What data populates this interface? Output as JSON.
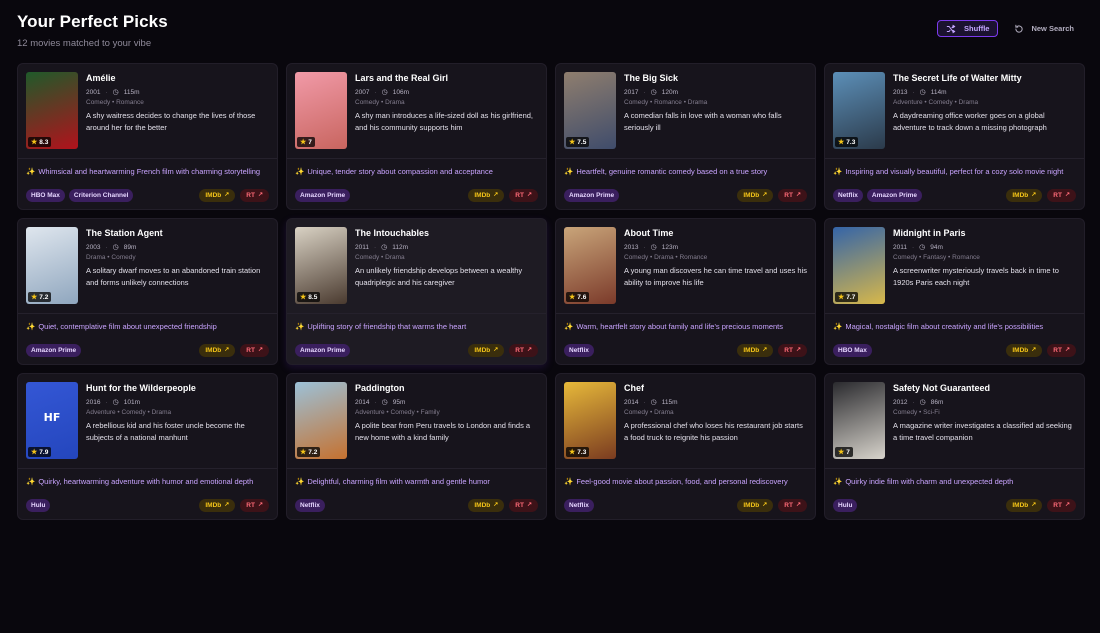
{
  "header": {
    "title": "Your Perfect Picks",
    "subtitle": "12 movies matched to your vibe",
    "shuffle_label": "Shuffle",
    "new_search_label": "New Search"
  },
  "labels": {
    "imdb": "IMDb",
    "rt": "RT"
  },
  "icons": {
    "shuffle": "shuffle-icon",
    "new_search": "refresh-icon",
    "clock": "clock-icon",
    "star": "star-icon",
    "sparkle": "sparkle-icon",
    "external": "external-link-icon"
  },
  "colors": {
    "accent": "#7c3aed",
    "vibe_text": "#c9a4ff",
    "imdb": "#f5c518",
    "rt": "#ff6b78",
    "card_bg": "#17141c",
    "page_bg": "#09070d"
  },
  "movies": [
    {
      "title": "Amélie",
      "year": "2001",
      "runtime": "115m",
      "genres": "Comedy • Romance",
      "rating": "8.3",
      "description": "A shy waitress decides to change the lives of those around her for the better",
      "vibe": "Whimsical and heartwarming French film with charming storytelling",
      "platforms": [
        "HBO Max",
        "Criterion Channel"
      ],
      "poster_colors": [
        "#1f5a2a",
        "#b2121c"
      ],
      "poster_text": ""
    },
    {
      "title": "Lars and the Real Girl",
      "year": "2007",
      "runtime": "106m",
      "genres": "Comedy • Drama",
      "rating": "7",
      "description": "A shy man introduces a life-sized doll as his girlfriend, and his community supports him",
      "vibe": "Unique, tender story about compassion and acceptance",
      "platforms": [
        "Amazon Prime"
      ],
      "poster_colors": [
        "#f19aa8",
        "#c8655f"
      ],
      "poster_text": ""
    },
    {
      "title": "The Big Sick",
      "year": "2017",
      "runtime": "120m",
      "genres": "Comedy • Romance • Drama",
      "rating": "7.5",
      "description": "A comedian falls in love with a woman who falls seriously ill",
      "vibe": "Heartfelt, genuine romantic comedy based on a true story",
      "platforms": [
        "Amazon Prime"
      ],
      "poster_colors": [
        "#8f7e6e",
        "#3f4c6b"
      ],
      "poster_text": ""
    },
    {
      "title": "The Secret Life of Walter Mitty",
      "year": "2013",
      "runtime": "114m",
      "genres": "Adventure • Comedy • Drama",
      "rating": "7.3",
      "description": "A daydreaming office worker goes on a global adventure to track down a missing photograph",
      "vibe": "Inspiring and visually beautiful, perfect for a cozy solo movie night",
      "platforms": [
        "Netflix",
        "Amazon Prime"
      ],
      "poster_colors": [
        "#5c8fb8",
        "#2b3a4a"
      ],
      "poster_text": ""
    },
    {
      "title": "The Station Agent",
      "year": "2003",
      "runtime": "89m",
      "genres": "Drama • Comedy",
      "rating": "7.2",
      "description": "A solitary dwarf moves to an abandoned train station and forms unlikely connections",
      "vibe": "Quiet, contemplative film about unexpected friendship",
      "platforms": [
        "Amazon Prime"
      ],
      "poster_colors": [
        "#dfe6ee",
        "#8fa6be"
      ],
      "poster_text": ""
    },
    {
      "title": "The Intouchables",
      "year": "2011",
      "runtime": "112m",
      "genres": "Comedy • Drama",
      "rating": "8.5",
      "description": "An unlikely friendship develops between a wealthy quadriplegic and his caregiver",
      "vibe": "Uplifting story of friendship that warms the heart",
      "platforms": [
        "Amazon Prime"
      ],
      "poster_colors": [
        "#d9d2c4",
        "#4a3a2f"
      ],
      "poster_text": ""
    },
    {
      "title": "About Time",
      "year": "2013",
      "runtime": "123m",
      "genres": "Comedy • Drama • Romance",
      "rating": "7.6",
      "description": "A young man discovers he can time travel and uses his ability to improve his life",
      "vibe": "Warm, heartfelt story about family and life's precious moments",
      "platforms": [
        "Netflix"
      ],
      "poster_colors": [
        "#c9a57a",
        "#7b3a2a"
      ],
      "poster_text": ""
    },
    {
      "title": "Midnight in Paris",
      "year": "2011",
      "runtime": "94m",
      "genres": "Comedy • Fantasy • Romance",
      "rating": "7.7",
      "description": "A screenwriter mysteriously travels back in time to 1920s Paris each night",
      "vibe": "Magical, nostalgic film about creativity and life's possibilities",
      "platforms": [
        "HBO Max"
      ],
      "poster_colors": [
        "#3464a8",
        "#d8b84a"
      ],
      "poster_text": ""
    },
    {
      "title": "Hunt for the Wilderpeople",
      "year": "2016",
      "runtime": "101m",
      "genres": "Adventure • Comedy • Drama",
      "rating": "7.9",
      "description": "A rebellious kid and his foster uncle become the subjects of a national manhunt",
      "vibe": "Quirky, heartwarming adventure with humor and emotional depth",
      "platforms": [
        "Hulu"
      ],
      "poster_colors": [
        "#3457d5",
        "#2446bd"
      ],
      "poster_text": "HF"
    },
    {
      "title": "Paddington",
      "year": "2014",
      "runtime": "95m",
      "genres": "Adventure • Comedy • Family",
      "rating": "7.2",
      "description": "A polite bear from Peru travels to London and finds a new home with a kind family",
      "vibe": "Delightful, charming film with warmth and gentle humor",
      "platforms": [
        "Netflix"
      ],
      "poster_colors": [
        "#9cc1d8",
        "#c5712f"
      ],
      "poster_text": ""
    },
    {
      "title": "Chef",
      "year": "2014",
      "runtime": "115m",
      "genres": "Comedy • Drama",
      "rating": "7.3",
      "description": "A professional chef who loses his restaurant job starts a food truck to reignite his passion",
      "vibe": "Feel-good movie about passion, food, and personal rediscovery",
      "platforms": [
        "Netflix"
      ],
      "poster_colors": [
        "#e7b93a",
        "#7a3b20"
      ],
      "poster_text": ""
    },
    {
      "title": "Safety Not Guaranteed",
      "year": "2012",
      "runtime": "86m",
      "genres": "Comedy • Sci-Fi",
      "rating": "7",
      "description": "A magazine writer investigates a classified ad seeking a time travel companion",
      "vibe": "Quirky indie film with charm and unexpected depth",
      "platforms": [
        "Hulu"
      ],
      "poster_colors": [
        "#2a2a2e",
        "#d8d4cc"
      ],
      "poster_text": ""
    }
  ]
}
